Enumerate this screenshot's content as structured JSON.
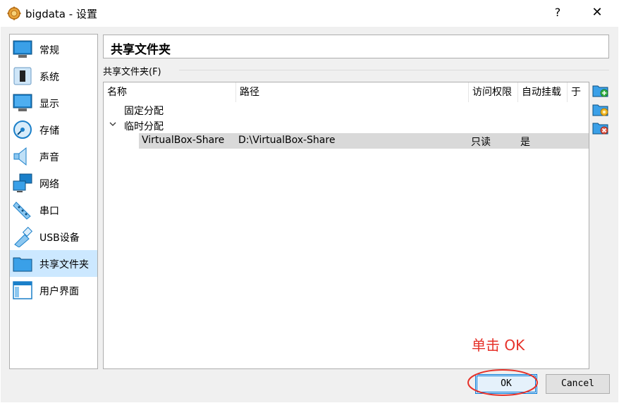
{
  "window": {
    "title": "bigdata - 设置",
    "help": "?",
    "close": "✕"
  },
  "sidebar": {
    "items": [
      {
        "label": "常规",
        "icon": "monitor-general-icon"
      },
      {
        "label": "系统",
        "icon": "system-chip-icon"
      },
      {
        "label": "显示",
        "icon": "display-monitor-icon"
      },
      {
        "label": "存储",
        "icon": "storage-disc-icon"
      },
      {
        "label": "声音",
        "icon": "speaker-icon"
      },
      {
        "label": "网络",
        "icon": "network-icon"
      },
      {
        "label": "串口",
        "icon": "serial-port-icon"
      },
      {
        "label": "USB设备",
        "icon": "usb-icon"
      },
      {
        "label": "共享文件夹",
        "icon": "shared-folder-icon"
      },
      {
        "label": "用户界面",
        "icon": "user-interface-icon"
      }
    ],
    "selected": "共享文件夹"
  },
  "page": {
    "title": "共享文件夹",
    "section_label": "共享文件夹(F)"
  },
  "table": {
    "columns": [
      "名称",
      "路径",
      "访问权限",
      "自动挂载",
      "于"
    ],
    "groups": [
      {
        "label": "固定分配",
        "expanded": false
      },
      {
        "label": "临时分配",
        "expanded": true
      }
    ],
    "rows": [
      {
        "name": "VirtualBox-Share",
        "path": "D:\\VirtualBox-Share",
        "access": "只读",
        "automount": "是",
        "at": ""
      }
    ]
  },
  "toolbar": {
    "add": "add-shared-folder-icon",
    "edit": "edit-shared-folder-icon",
    "remove": "remove-shared-folder-icon"
  },
  "annotation": {
    "text": "单击 OK",
    "color": "#e6322a"
  },
  "buttons": {
    "ok": "OK",
    "cancel": "Cancel"
  },
  "colors": {
    "selected_sidebar": "#cce8ff",
    "selected_row": "#d9d9d9",
    "accent": "#0078d7"
  }
}
